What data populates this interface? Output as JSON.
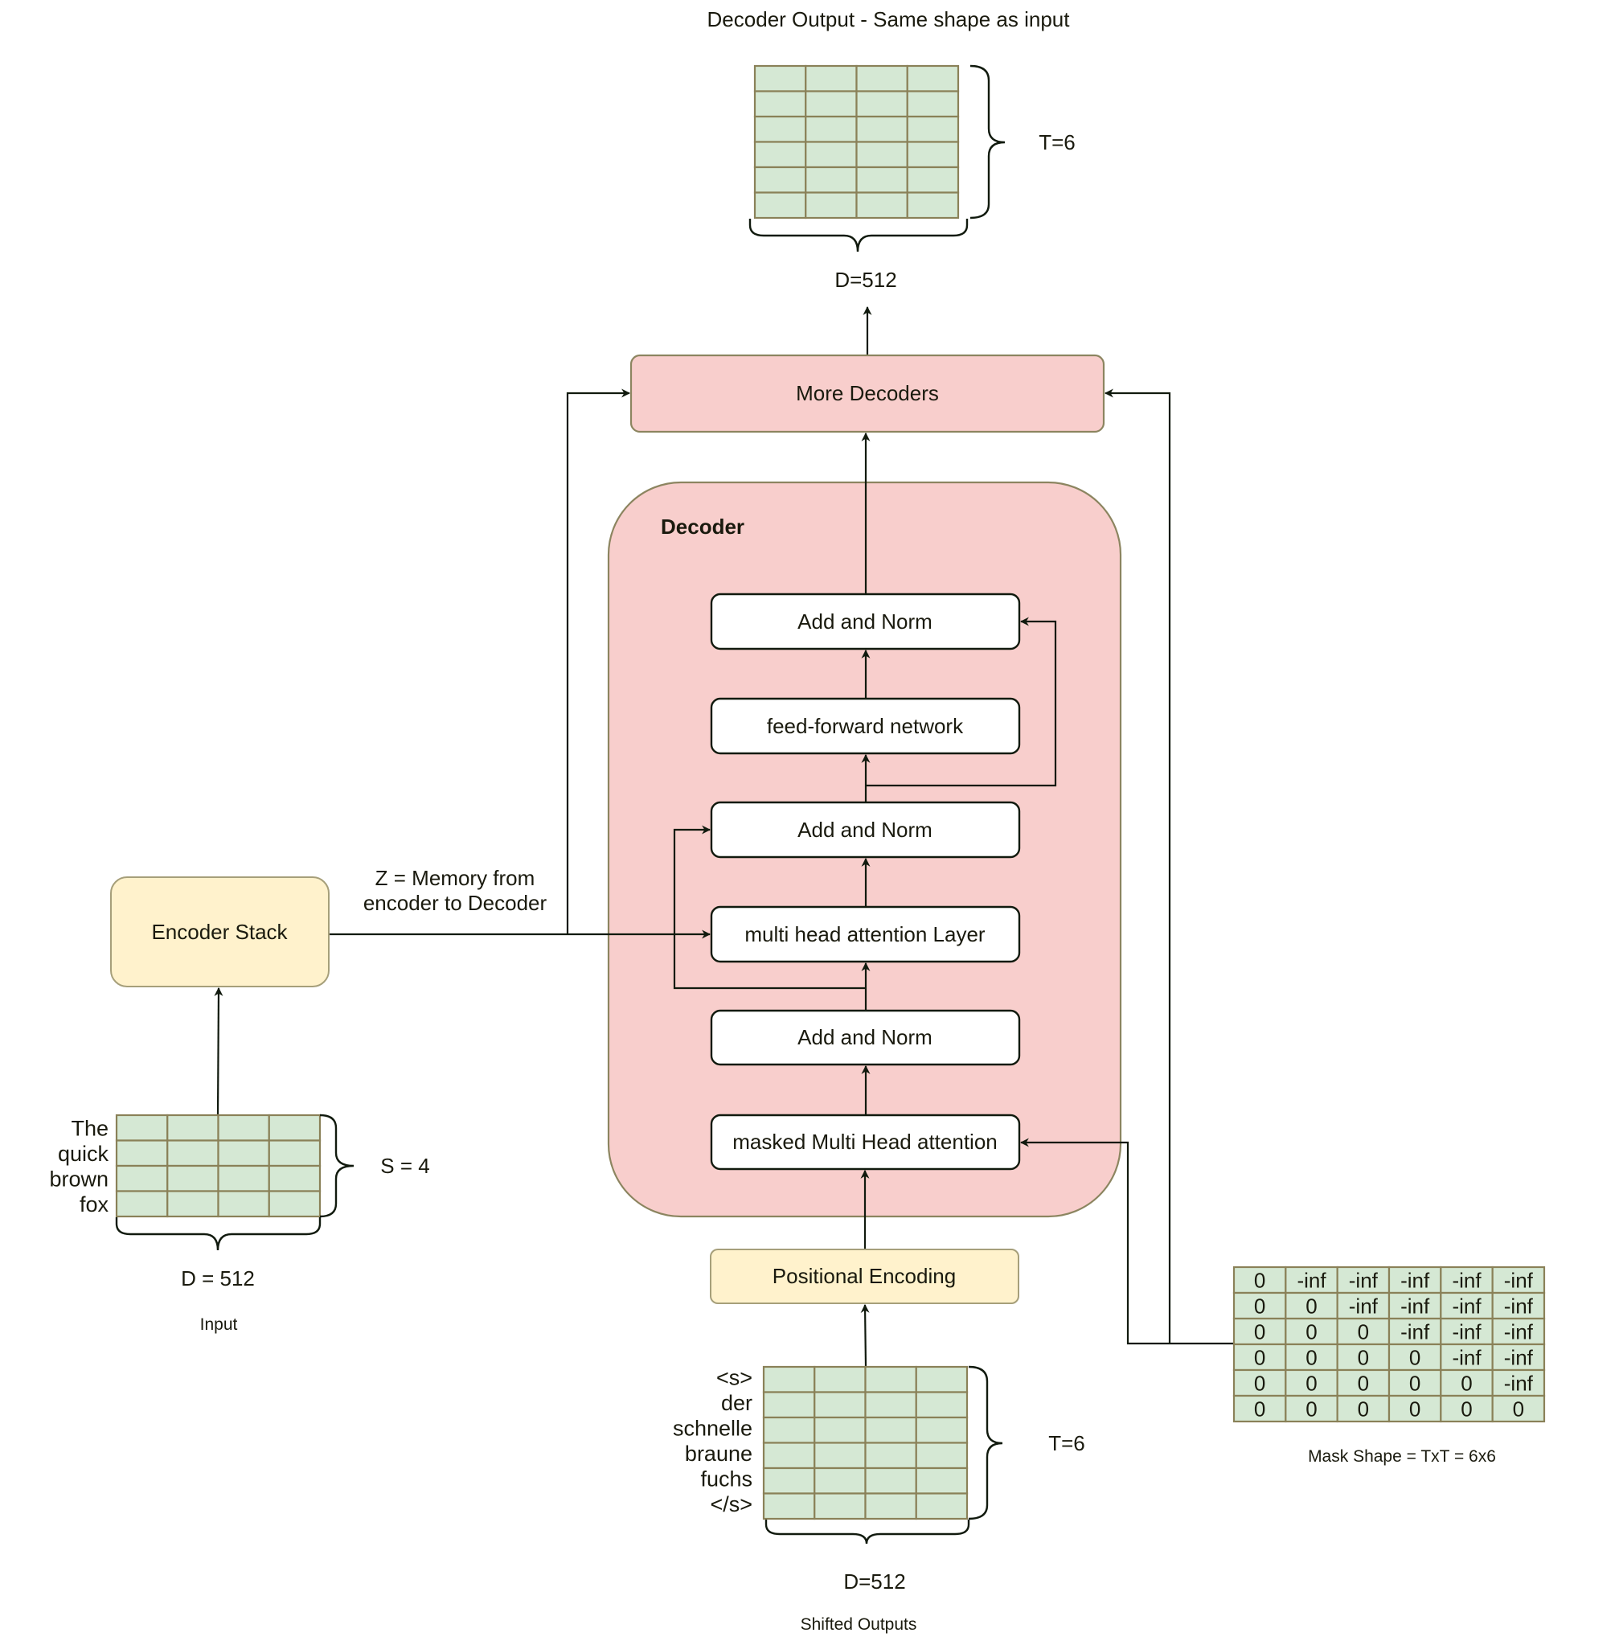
{
  "output": {
    "title": "Decoder Output - Same shape as input",
    "rows_label": "T=6",
    "cols_label": "D=512",
    "rows": 6,
    "cols": 4
  },
  "more_decoders": {
    "label": "More Decoders"
  },
  "decoder": {
    "title": "Decoder",
    "layers": [
      {
        "id": "add-norm-3",
        "label": "Add and Norm"
      },
      {
        "id": "feed-forward",
        "label": "feed-forward network"
      },
      {
        "id": "add-norm-2",
        "label": "Add and Norm"
      },
      {
        "id": "cross-attention",
        "label": "multi head attention Layer"
      },
      {
        "id": "add-norm-1",
        "label": "Add and Norm"
      },
      {
        "id": "masked-attention",
        "label": "masked Multi Head attention"
      }
    ]
  },
  "positional_encoding": {
    "label": "Positional Encoding"
  },
  "encoder": {
    "label": "Encoder Stack",
    "memory_label_line1": "Z = Memory from",
    "memory_label_line2": "encoder to Decoder"
  },
  "input": {
    "tokens": [
      "The",
      "quick",
      "brown",
      "fox"
    ],
    "rows_label": "S = 4",
    "cols_label": "D = 512",
    "caption": "Input",
    "cols": 4
  },
  "shifted_outputs": {
    "tokens": [
      "<s>",
      "der",
      "schnelle",
      "braune",
      "fuchs",
      "</s>"
    ],
    "rows_label": "T=6",
    "cols_label": "D=512",
    "caption": "Shifted Outputs",
    "cols": 4
  },
  "mask": {
    "caption": "Mask Shape = TxT = 6x6",
    "values": [
      [
        "0",
        "-inf",
        "-inf",
        "-inf",
        "-inf",
        "-inf"
      ],
      [
        "0",
        "0",
        "-inf",
        "-inf",
        "-inf",
        "-inf"
      ],
      [
        "0",
        "0",
        "0",
        "-inf",
        "-inf",
        "-inf"
      ],
      [
        "0",
        "0",
        "0",
        "0",
        "-inf",
        "-inf"
      ],
      [
        "0",
        "0",
        "0",
        "0",
        "0",
        "-inf"
      ],
      [
        "0",
        "0",
        "0",
        "0",
        "0",
        "0"
      ]
    ]
  },
  "colors": {
    "decoder_fill": "#f8cecc",
    "encoder_fill": "#fff2cc",
    "matrix_fill": "#d5e8d4"
  }
}
